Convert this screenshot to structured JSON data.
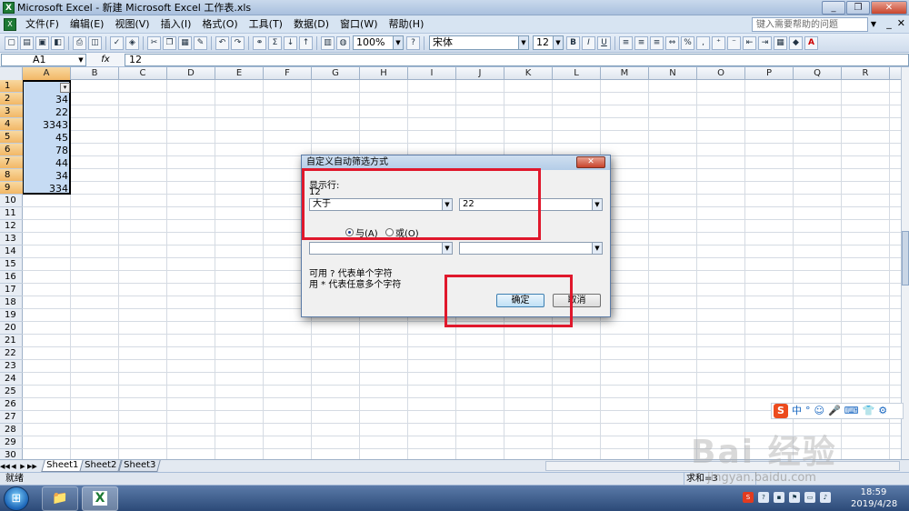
{
  "window": {
    "title": "Microsoft Excel - 新建 Microsoft Excel 工作表.xls",
    "app_icon": "excel-icon",
    "controls": [
      "_",
      "❐",
      "✕"
    ]
  },
  "menu": {
    "items": [
      "文件(F)",
      "编辑(E)",
      "视图(V)",
      "插入(I)",
      "格式(O)",
      "工具(T)",
      "数据(D)",
      "窗口(W)",
      "帮助(H)"
    ],
    "help_placeholder": "键入需要帮助的问题",
    "controls": [
      "_",
      "✕"
    ]
  },
  "toolbar": {
    "zoom": "100%",
    "font": "宋体",
    "font_size": "12",
    "bold": "B",
    "italic": "I",
    "underline": "U",
    "percent": "%",
    "sum": "Σ"
  },
  "formula_bar": {
    "name_box": "A1",
    "fx": "fx",
    "value": "12"
  },
  "grid": {
    "columns": [
      "A",
      "B",
      "C",
      "D",
      "E",
      "F",
      "G",
      "H",
      "I",
      "J",
      "K",
      "L",
      "M",
      "N",
      "O",
      "P",
      "Q",
      "R"
    ],
    "rows": [
      "1",
      "2",
      "3",
      "4",
      "5",
      "6",
      "7",
      "8",
      "9",
      "10",
      "11",
      "12",
      "13",
      "14",
      "15",
      "16",
      "17",
      "18",
      "19",
      "20",
      "21",
      "22",
      "23",
      "24",
      "25",
      "26",
      "27",
      "28",
      "29",
      "30"
    ],
    "a_values": [
      "",
      "34",
      "22",
      "3343",
      "45",
      "78",
      "44",
      "34",
      "334"
    ],
    "filter_arrow": "▾"
  },
  "sheets": {
    "nav": [
      "◀◀",
      "◀",
      "▶",
      "▶▶"
    ],
    "tabs": [
      "Sheet1",
      "Sheet2",
      "Sheet3"
    ]
  },
  "status": {
    "ready": "就绪",
    "sum": "求和=3"
  },
  "ime": {
    "logo": "S",
    "items": [
      "中",
      "°",
      "☺",
      "🎤",
      "⌨",
      "👕",
      "⚙"
    ]
  },
  "taskbar": {
    "time": "18:59",
    "date": "2019/4/28"
  },
  "watermark": {
    "text": "Bai 经验",
    "url": "jingyan.baidu.com"
  },
  "dialog": {
    "title": "自定义自动筛选方式",
    "close": "✕",
    "show_rows_label": "显示行:",
    "field_name": "12",
    "cond1_operator": "大于",
    "cond1_value": "22",
    "and_label": "与(A)",
    "or_label": "或(O)",
    "cond2_operator": "",
    "cond2_value": "",
    "hint1": "可用 ? 代表单个字符",
    "hint2": "用 * 代表任意多个字符",
    "ok": "确定",
    "cancel": "取消"
  },
  "accent_colors": {
    "selection": "#c6dbf3",
    "header_selected": "#f2b766",
    "annotation_red": "#e0182c"
  }
}
